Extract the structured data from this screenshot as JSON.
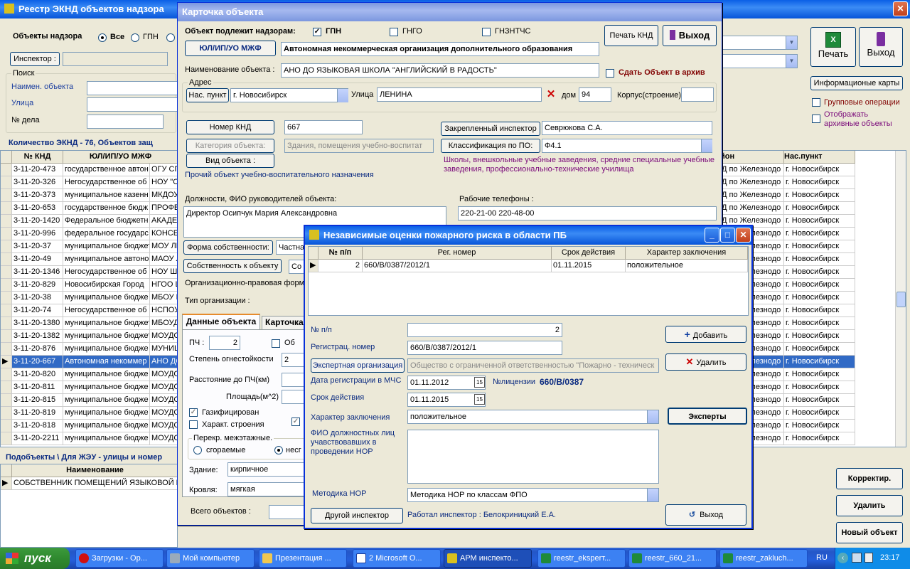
{
  "main": {
    "title": "Реестр ЭКНД объектов надзора",
    "objects_label": "Объекты надзора",
    "radio_all": "Все",
    "radio_gpn": "ГПН",
    "inspector_btn": "Инспектор :",
    "search_label": "Поиск",
    "search_name": "Наимен. объекта",
    "search_street": "Улица",
    "search_case": "№ дела",
    "count_text": "Количество ЭКНД - 76,  Объектов защ",
    "print": "Печать",
    "exit": "Выход",
    "info_cards": "Информационые карты",
    "group_ops": "Групповые операции",
    "show_archived": "Отображать архивные объекты",
    "cols": [
      "№ КНД",
      "ЮЛ/ИП/УО МЖФ",
      "йон",
      "Нас.пункт"
    ],
    "rows": [
      [
        "3-11-20-473",
        "государственное автон",
        "ОГУ СП",
        "Д по Железнодо",
        "г. Новосибирск"
      ],
      [
        "3-11-20-326",
        "Негосударственное об",
        "НОУ \"С",
        "Д по Железнодо",
        "г. Новосибирск"
      ],
      [
        "3-11-20-373",
        "муниципальное казенн",
        "МКДОУ",
        "Д по Железнодо",
        "г. Новосибирск"
      ],
      [
        "3-11-20-653",
        "государственное бюдж",
        "ПРОФЕ",
        "Д по Железнодо",
        "г. Новосибирск"
      ],
      [
        "3-11-20-1420",
        "Федеральное бюджетн",
        "АКАДЕ",
        "Д по Железнодо",
        "г. Новосибирск"
      ],
      [
        "3-11-20-996",
        "федеральное государс",
        "КОНСЕ",
        "Д по Железнодо",
        "г. Новосибирск"
      ],
      [
        "3-11-20-37",
        "муниципальное бюджет",
        "МОУ ЛИ",
        "Д по Железнодо",
        "г. Новосибирск"
      ],
      [
        "3-11-20-49",
        "муниципальное автоно",
        "МАОУ Л",
        "Д по Железнодо",
        "г. Новосибирск"
      ],
      [
        "3-11-20-1346",
        "Негосударственное об",
        "НОУ Ш",
        "Д по Железнодо",
        "г. Новосибирск"
      ],
      [
        "3-11-20-829",
        "Новосибирская Город",
        "НГОО Ц",
        "Д по Железнодо",
        "г. Новосибирск"
      ],
      [
        "3-11-20-38",
        "муниципальное бюдже",
        "МБОУ Г",
        "Д по Железнодо",
        "г. Новосибирск"
      ],
      [
        "3-11-20-74",
        "Негосударственное об",
        "НСПОУ",
        "Д по Железнодо",
        "г. Новосибирск"
      ],
      [
        "3-11-20-1380",
        "муниципальное бюджет",
        "МБОУД",
        "Д по Железнодо",
        "г. Новосибирск"
      ],
      [
        "3-11-20-1382",
        "муниципальное бюджет",
        "МОУДС",
        "Д по Железнодо",
        "г. Новосибирск"
      ],
      [
        "3-11-20-876",
        "муниципальное бюдже",
        "МУНИЦ",
        "Д по Железнодо",
        "г. Новосибирск"
      ],
      [
        "3-11-20-667",
        "Автономная некоммер",
        "АНО ДО",
        "Д по Железнодо",
        "г. Новосибирск"
      ],
      [
        "3-11-20-820",
        "муниципальное бюдже",
        "МОУДС",
        "Д по Железнодо",
        "г. Новосибирск"
      ],
      [
        "3-11-20-811",
        "муниципальное бюдже",
        "МОУДС",
        "Д по Железнодо",
        "г. Новосибирск"
      ],
      [
        "3-11-20-815",
        "муниципальное бюдже",
        "МОУДС",
        "Д по Железнодо",
        "г. Новосибирск"
      ],
      [
        "3-11-20-819",
        "муниципальное бюдже",
        "МОУДС",
        "Д по Железнодо",
        "г. Новосибирск"
      ],
      [
        "3-11-20-818",
        "муниципальное бюдже",
        "МОУДС",
        "Д по Железнодо",
        "г. Новосибирск"
      ],
      [
        "3-11-20-2211",
        "муниципальное бюдже",
        "МОУДС",
        "Д по Железнодо",
        "г. Новосибирск"
      ]
    ],
    "sub_header": "Подобъекты \\ Для ЖЭУ - улицы и номер",
    "sub_col": "Наименование",
    "sub_row": "СОБСТВЕННИК ПОМЕЩЕНИЙ ЯЗЫКОВОЙ Ш",
    "btn_correct": "Корректир.",
    "btn_delete": "Удалить",
    "btn_new": "Новый объект"
  },
  "card": {
    "title": "Карточка объекта",
    "supervision": "Объект подлежит надзорам:",
    "gpn": "ГПН",
    "gngo": "ГНГО",
    "gnztchs": "ГНЗНТЧС",
    "print_knd": "Печать КНД",
    "exit": "Выход",
    "ul_btn": "ЮЛ/ИП/УО МЖФ",
    "org_full": "Автономная некоммерческая организация дополнительного образования",
    "name_label": "Наименование объекта :",
    "name_value": "АНО ДО ЯЗЫКОВАЯ ШКОЛА \"АНГЛИЙСКИЙ В РАДОСТЬ\"",
    "archive": "Сдать Объект в архив",
    "addr": "Адрес",
    "city_btn": "Нас. пункт",
    "city": "г. Новосибирск",
    "street_label": "Улица",
    "street": "ЛЕНИНА",
    "house_label": "дом",
    "house": "94",
    "corpus_label": "Корпус(строение)",
    "knd_btn": "Номер КНД",
    "knd": "667",
    "insp_btn": "Закрепленный инспектор",
    "insp": "Севрюкова С.А.",
    "cat_btn": "Категория объекта:",
    "cat": "Здания, помещения учебно-воспитат",
    "class_btn": "Классификация по ПО:",
    "class_val": "Ф4.1",
    "class_desc": "Школы, внешкольные учебные заведения, средние специальные учебные заведения, профессионально-технические училища",
    "kind_btn": "Вид объекта :",
    "kind_desc": "Прочий объект учебно-воспитательного назначения",
    "heads_label": "Должности, ФИО руководителей объекта:",
    "heads": "Директор Осипчук Мария Александровна",
    "phones_label": "Рабочие телефоны :",
    "phones": "220-21-00 220-48-00",
    "own_form_btn": "Форма собственности:",
    "own_form": "Частна",
    "own_btn": "Собственность к объекту",
    "own_val": "Со",
    "org_legal": "Организационно-правовая форм",
    "org_type": "Тип организации :",
    "tab1": "Данные объекта",
    "tab2": "Карточка",
    "pch": "ПЧ :",
    "pch_val": "2",
    "ob": "Об",
    "fire_res": "Степень огнестойкости",
    "fire_res_val": "2",
    "dist": "Расстояние до ПЧ(км)",
    "area": "Площадь(м^2)",
    "gas": "Газифицирован",
    "struct": "Характ. строения",
    "floors": "Перекр. межэтажные.",
    "burn": "сгораемые",
    "nonburn": "несг",
    "building": "Здание:",
    "building_val": "кирпичное",
    "roof": "Кровля:",
    "roof_val": "мягкая",
    "total": "Всего объектов :"
  },
  "dlg": {
    "title": "Независимые оценки пожарного риска в области ПБ",
    "cols": [
      "№ п/п",
      "Рег. номер",
      "Срок действия",
      "Характер заключения"
    ],
    "row": [
      "2",
      "660/В/0387/2012/1",
      "01.11.2015",
      "положительное"
    ],
    "np_label": "№ п/п",
    "np": "2",
    "reg_label": "Регистрац. номер",
    "reg": "660/В/0387/2012/1",
    "expert_btn": "Экспертная организация",
    "expert": "Общество с ограниченной ответственностью \"Пожарно - техническ",
    "date_label": "Дата регистрации в МЧС",
    "date": "01.11.2012",
    "lic_label": "№лицензии",
    "lic": "660/В/0387",
    "term_label": "Срок действия",
    "term": "01.11.2015",
    "char_label": "Характер заключения",
    "char": "положительное",
    "fio_label": "ФИО должностных лиц учавствовавших в проведении НОР",
    "method_label": "Методика НОР",
    "method": "Методика НОР по классам ФПО",
    "other_insp": "Другой инспектор",
    "worked": "Работал инспектор :  Белокриницкий Е.А.",
    "add": "Добавить",
    "del": "Удалить",
    "experts": "Эксперты",
    "exit": "Выход"
  },
  "taskbar": {
    "start": "пуск",
    "items": [
      "Загрузки - Op...",
      "Мой компьютер",
      "Презентация ...",
      "2 Microsoft O...",
      "АРМ инспекто...",
      "reestr_eksperт...",
      "reestr_660_21...",
      "reestr_zakluch..."
    ],
    "lang": "RU",
    "time": "23:17"
  },
  "colors": {
    "title": "#0a5fe6",
    "select": "#316ac5",
    "brown": "#800000",
    "purple": "#7a0a7a"
  }
}
